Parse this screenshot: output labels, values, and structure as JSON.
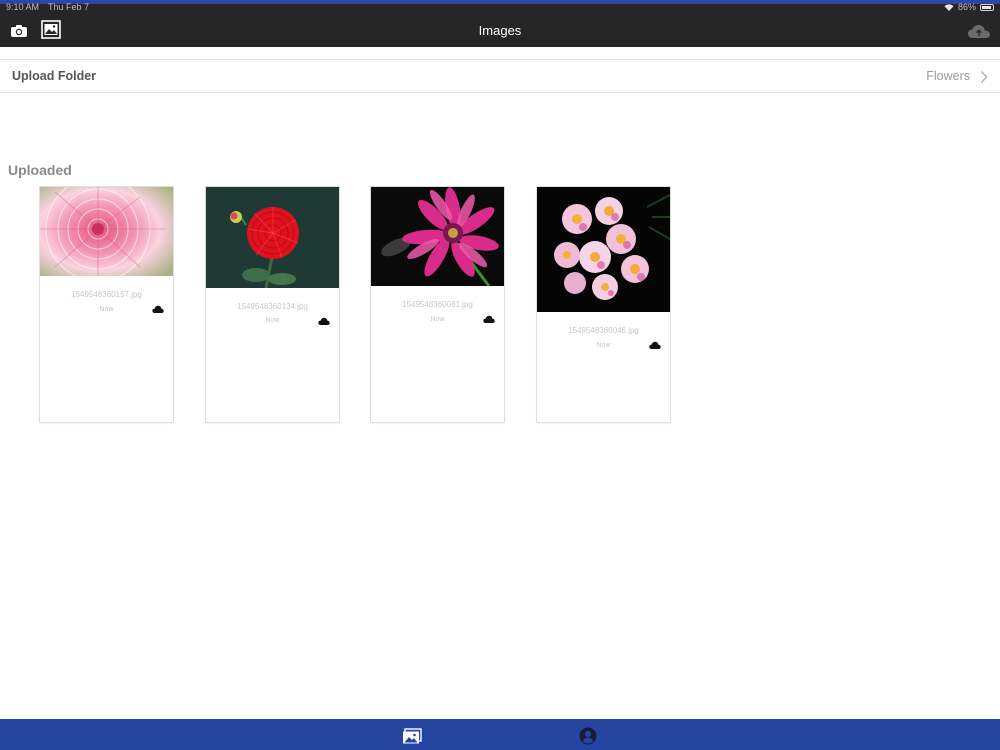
{
  "status": {
    "time": "9:10 AM",
    "date": "Thu Feb 7",
    "battery": "86%"
  },
  "navbar": {
    "title": "Images"
  },
  "upload_folder": {
    "label": "Upload Folder",
    "value": "Flowers"
  },
  "section": {
    "title": "Uploaded"
  },
  "images": [
    {
      "filename": "1549548360157.jpg",
      "time": "Now"
    },
    {
      "filename": "1549548360134.jpg",
      "time": "Now"
    },
    {
      "filename": "1549548360081.jpg",
      "time": "Now"
    },
    {
      "filename": "1549548360046.jpg",
      "time": "Now"
    }
  ],
  "icons": {
    "camera": "camera-icon",
    "gallery": "gallery-icon",
    "cloud_upload": "cloud-upload-icon",
    "chevron": "chevron-right-icon",
    "cloud_status": "cloud-icon",
    "tab_images": "images-tab-icon",
    "tab_account": "account-icon"
  },
  "colors": {
    "navbar": "#262626",
    "tabbar": "#2444a0",
    "accent_strip": "#2a47a8"
  }
}
